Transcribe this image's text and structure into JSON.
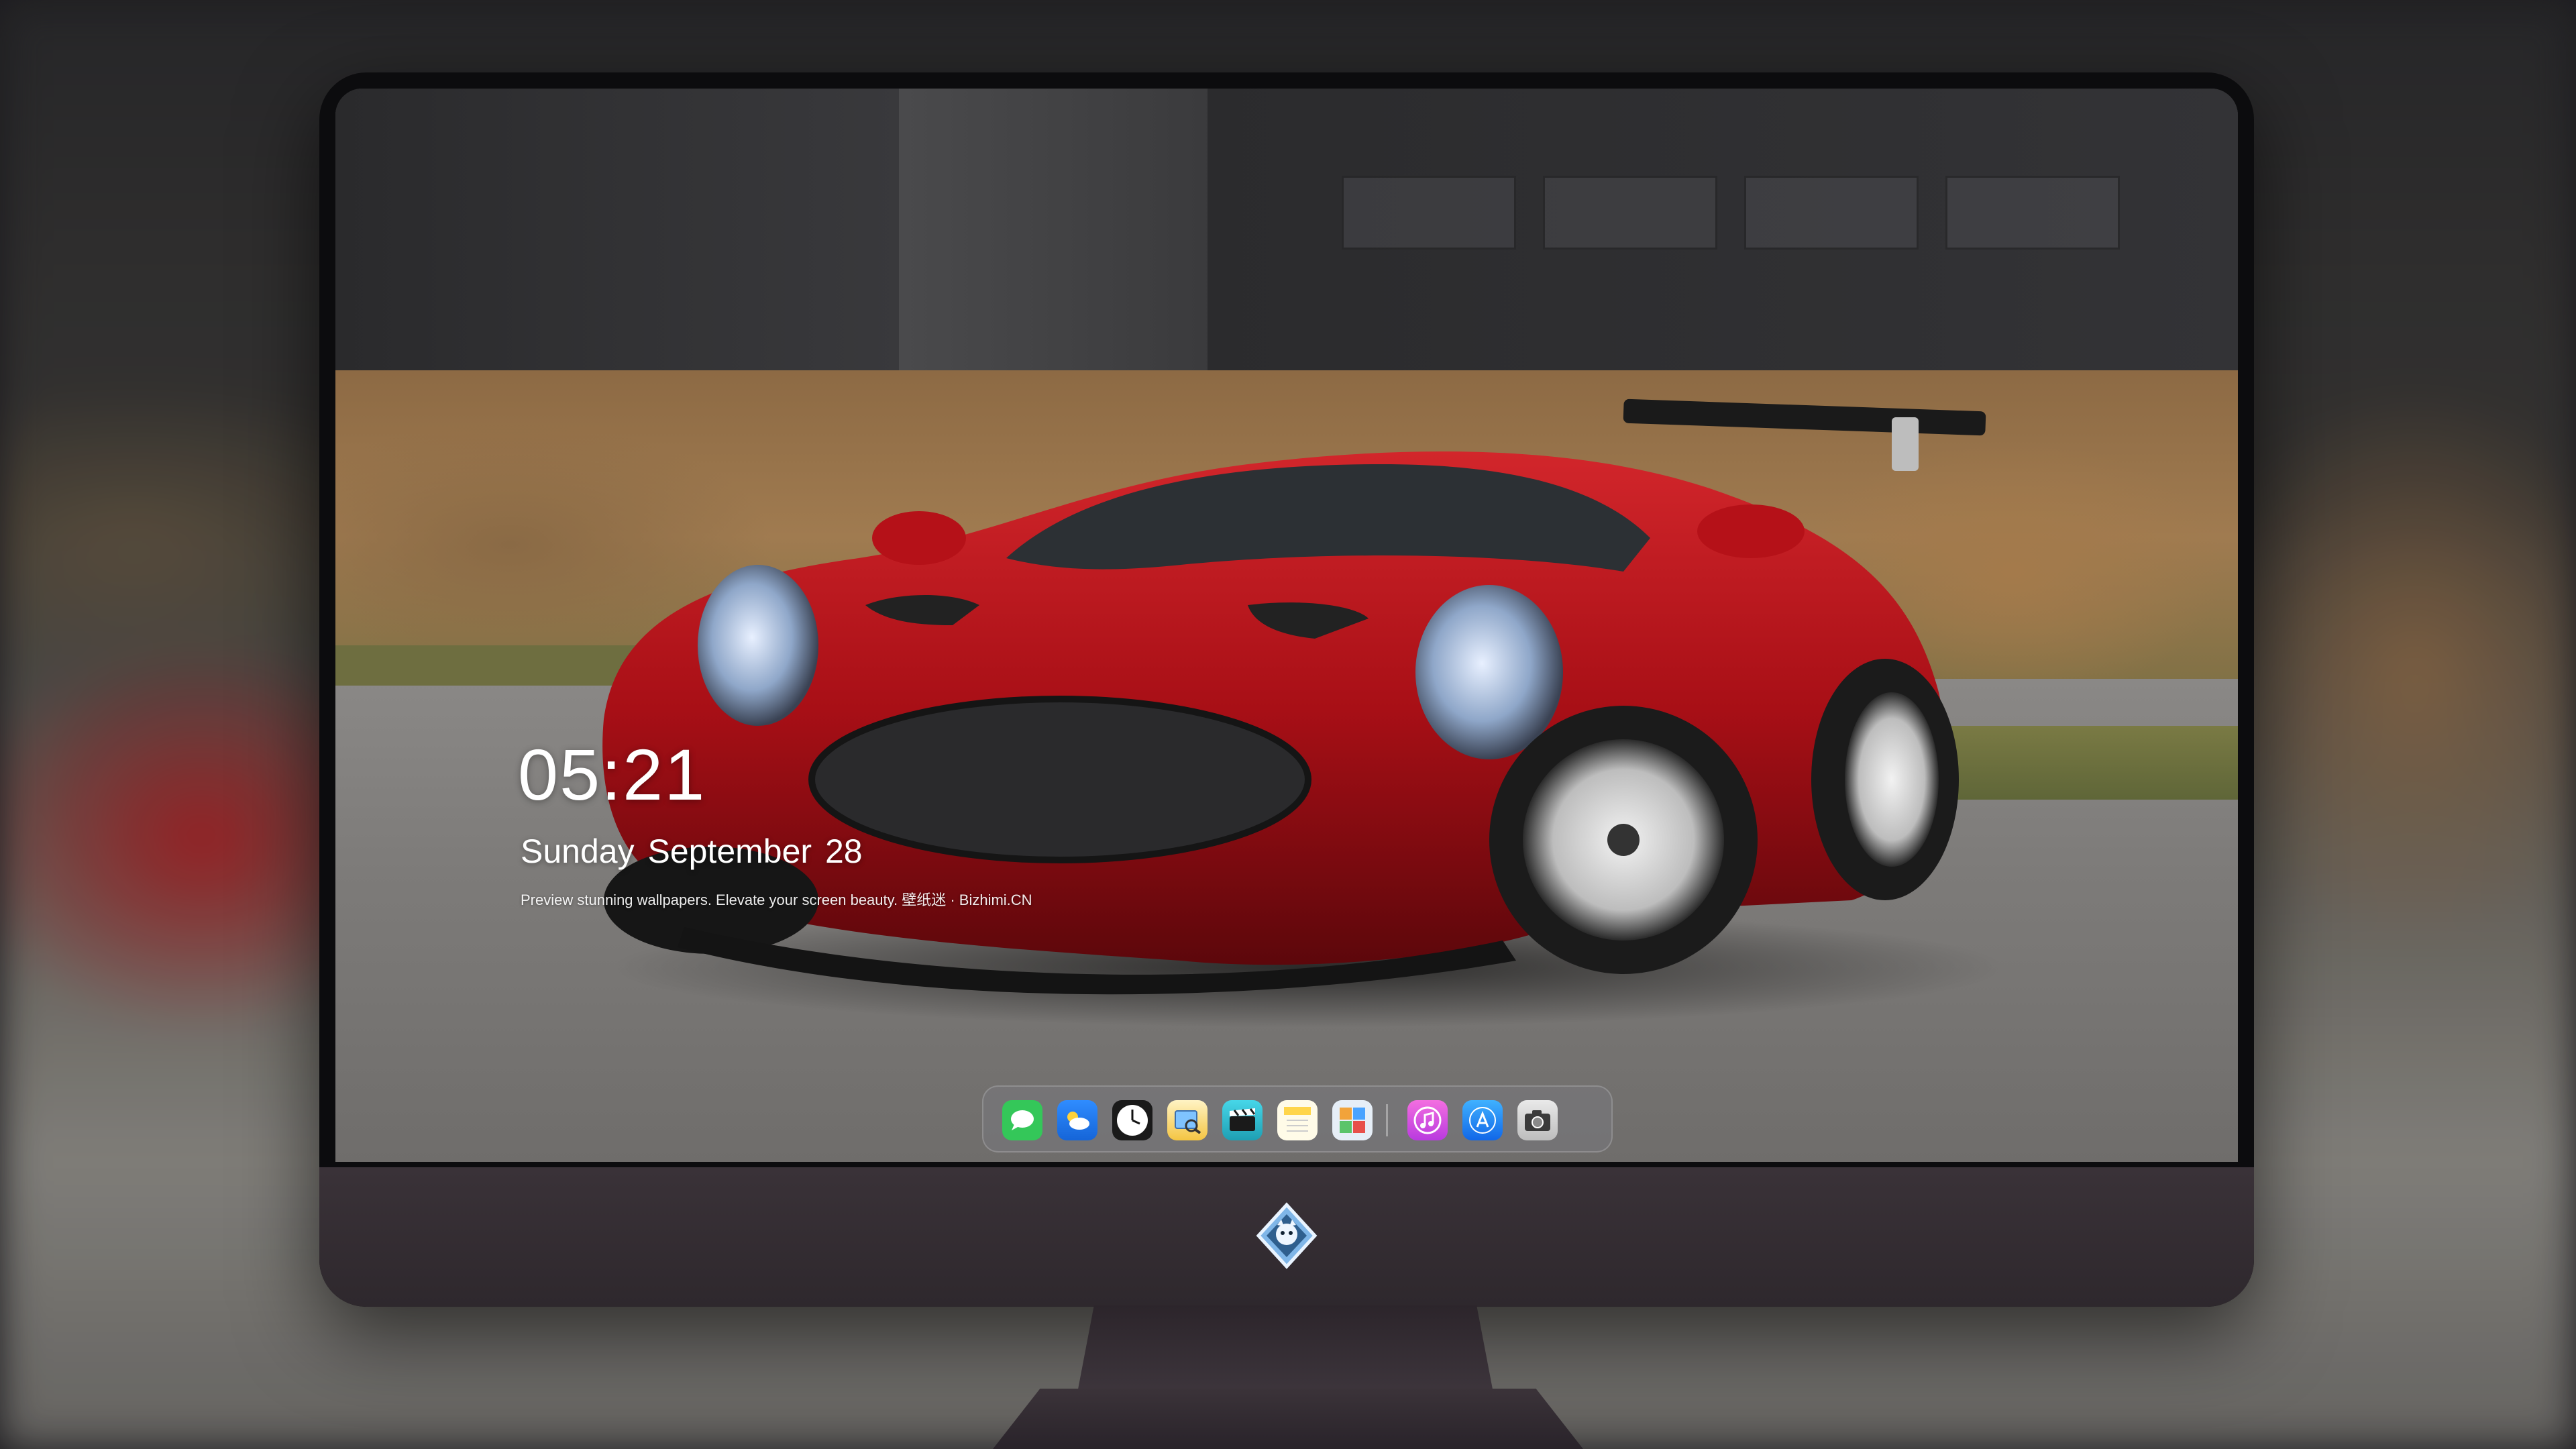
{
  "lock_screen": {
    "time": "05:21",
    "date": "Sunday September  28",
    "tagline": "Preview stunning wallpapers. Elevate your screen beauty. 壁纸迷 · Bizhimi.CN"
  },
  "dock": {
    "apps": [
      {
        "name": "Messages",
        "icon": "messages-icon",
        "color": "#34c759"
      },
      {
        "name": "Weather",
        "icon": "weather-icon",
        "color": "#1e90ff"
      },
      {
        "name": "Clock",
        "icon": "clock-icon",
        "color": "#ffffff"
      },
      {
        "name": "Preview",
        "icon": "preview-icon",
        "color": "#f4c542"
      },
      {
        "name": "Clips",
        "icon": "clips-icon",
        "color": "#2ec4d6"
      },
      {
        "name": "Notes",
        "icon": "notes-icon",
        "color": "#ffd54a"
      },
      {
        "name": "Photo Booth",
        "icon": "photo-booth-icon",
        "color": "#3aa0ff"
      },
      {
        "name": "iTunes",
        "icon": "itunes-icon",
        "color": "#e94fd1"
      },
      {
        "name": "App Store",
        "icon": "app-store-icon",
        "color": "#1c8cf6"
      },
      {
        "name": "Camera",
        "icon": "camera-icon",
        "color": "#d9d9d9"
      }
    ]
  },
  "colors": {
    "monitor_chin": "#342d33",
    "car_red": "#b0121a",
    "text": "#ffffff"
  }
}
